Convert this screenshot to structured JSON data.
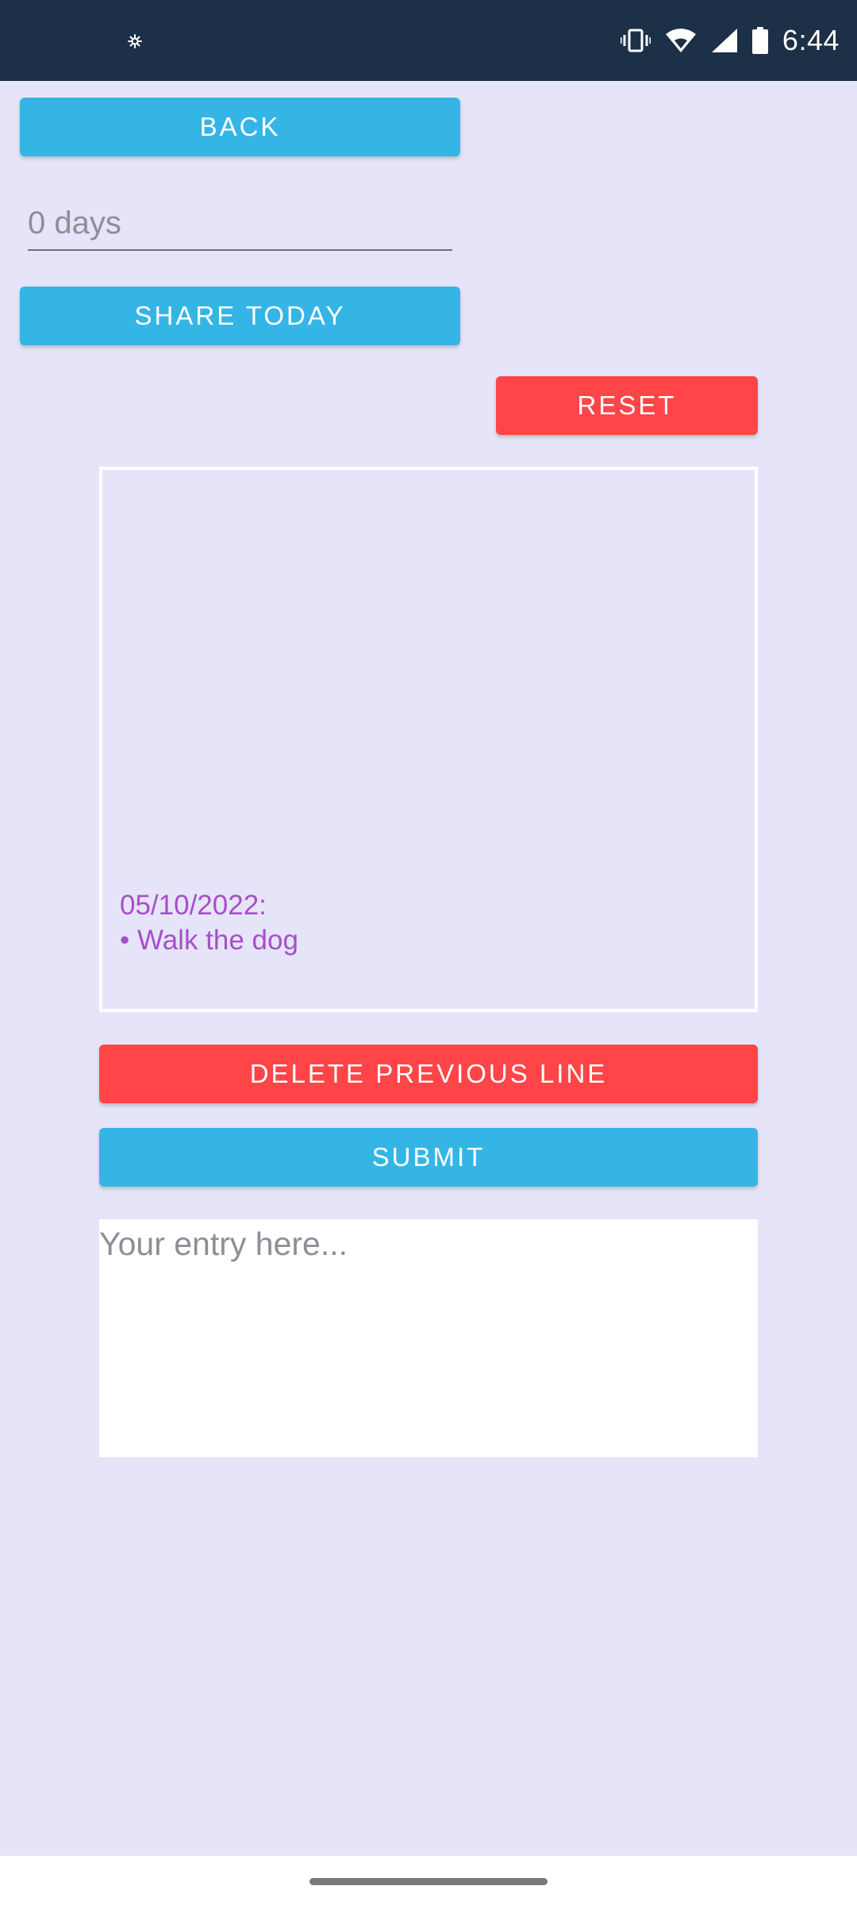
{
  "status_bar": {
    "time": "6:44",
    "left_icon": "sparkle-icon",
    "icons": [
      "vibrate-icon",
      "wifi-icon",
      "signal-icon",
      "battery-icon"
    ]
  },
  "back_button": {
    "label": "BACK"
  },
  "days_field": {
    "value": "",
    "placeholder": "0 days"
  },
  "share_button": {
    "label": "SHARE TODAY"
  },
  "reset_button": {
    "label": "RESET"
  },
  "entries": {
    "date": "05/10/2022:",
    "items": [
      "• Walk the dog"
    ]
  },
  "delete_button": {
    "label": "DELETE PREVIOUS LINE"
  },
  "submit_button": {
    "label": "SUBMIT"
  },
  "entry_input": {
    "value": "",
    "placeholder": "Your entry here..."
  },
  "colors": {
    "background": "#E5E4F8",
    "status_bar": "#1C3048",
    "primary_button": "#35B5E5",
    "danger_button": "#FF4548",
    "entry_text": "#A64FC9"
  }
}
